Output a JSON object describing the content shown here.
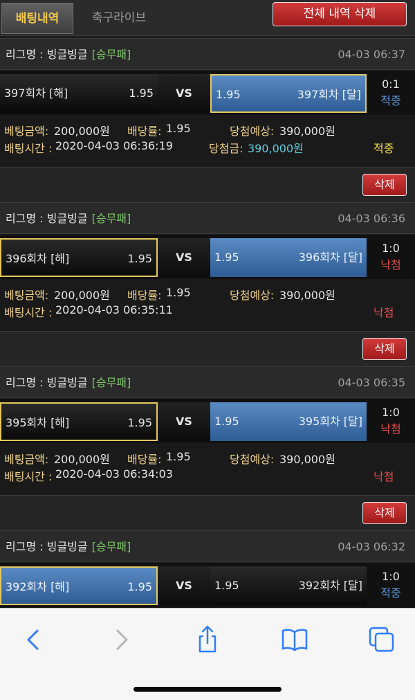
{
  "tabs": {
    "active": "배팅내역",
    "inactive": "축구라이브"
  },
  "delete_all_label": "전체 내역 삭제",
  "labels": {
    "league_prefix": "리그명 : ",
    "bet_amount": "베팅금액:",
    "odds": "배당률:",
    "expected": "당첨예상:",
    "bet_time": "배팅시간 : ",
    "prize": "당첨금:",
    "vs": "VS",
    "delete": "삭제"
  },
  "bets": [
    {
      "league": "빙글빙글",
      "type": "[승무패]",
      "time": "04-03 06:37",
      "home": {
        "name": "397회차 [해]",
        "odds": "1.95"
      },
      "away": {
        "name": "397회차 [달]",
        "odds": "1.95"
      },
      "score": "0:1",
      "score_status": "적중",
      "amount": "200,000원",
      "rate": "1.95",
      "expected": "390,000원",
      "bet_time": "2020-04-03 06:36:19",
      "prize": "390,000원",
      "status": "적중"
    },
    {
      "league": "빙글빙글",
      "type": "[승무패]",
      "time": "04-03 06:36",
      "home": {
        "name": "396회차 [해]",
        "odds": "1.95"
      },
      "away": {
        "name": "396회차 [달]",
        "odds": "1.95"
      },
      "score": "1:0",
      "score_status": "낙첨",
      "amount": "200,000원",
      "rate": "1.95",
      "expected": "390,000원",
      "bet_time": "2020-04-03 06:35:11",
      "status": "낙첨"
    },
    {
      "league": "빙글빙글",
      "type": "[승무패]",
      "time": "04-03 06:35",
      "home": {
        "name": "395회차 [해]",
        "odds": "1.95"
      },
      "away": {
        "name": "395회차 [달]",
        "odds": "1.95"
      },
      "score": "1:0",
      "score_status": "낙첨",
      "amount": "200,000원",
      "rate": "1.95",
      "expected": "390,000원",
      "bet_time": "2020-04-03 06:34:03",
      "status": "낙첨"
    },
    {
      "league": "빙글빙글",
      "type": "[승무패]",
      "time": "04-03 06:32",
      "home": {
        "name": "392회차 [해]",
        "odds": "1.95"
      },
      "away": {
        "name": "392회차 [달]",
        "odds": "1.95"
      },
      "score": "1:0",
      "score_status": "적중"
    }
  ],
  "colors": {
    "win_yellow": "#f0d850",
    "lose_red": "#e24d4d",
    "hit_blue": "#5a9de0",
    "prize_cyan": "#5fd0e0",
    "league_green": "#7ec96a",
    "select_border": "#e5c85b"
  },
  "toolbar_icons": [
    "back-chevron-icon",
    "forward-chevron-icon",
    "share-icon",
    "bookmarks-icon",
    "tabs-icon"
  ]
}
